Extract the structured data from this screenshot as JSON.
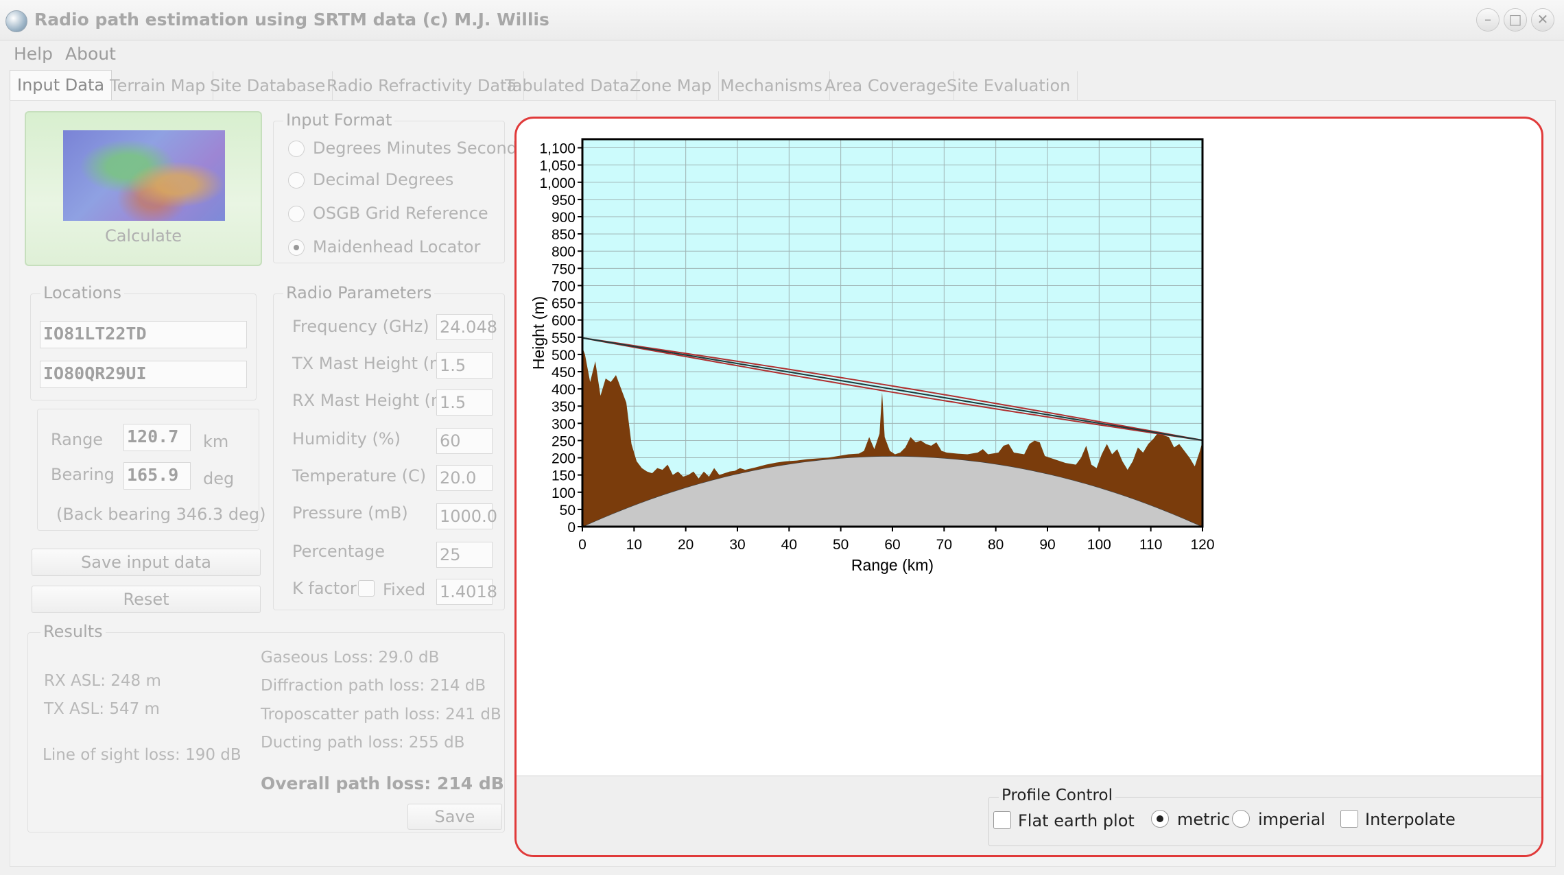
{
  "window": {
    "title": "Radio path estimation using SRTM data (c) M.J. Willis",
    "controls": {
      "minimize": "–",
      "maximize": "□",
      "close": "✕"
    }
  },
  "menu": [
    "Help",
    "About"
  ],
  "tabs": [
    "Input Data",
    "Terrain Map",
    "Site Database",
    "Radio Refractivity Data",
    "Tabulated Data",
    "Zone Map",
    "Mechanisms",
    "Area Coverage",
    "Site Evaluation"
  ],
  "calculate": {
    "label": "Calculate"
  },
  "input_format": {
    "legend": "Input Format",
    "options": [
      "Degrees Minutes Seconds",
      "Decimal Degrees",
      "OSGB Grid Reference",
      "Maidenhead Locator"
    ],
    "selected": "Maidenhead Locator"
  },
  "locations": {
    "legend": "Locations",
    "loc1": "IO81LT22TD",
    "loc2": "IO80QR29UI",
    "range_label": "Range",
    "range_value": "120.7",
    "range_unit": "km",
    "bearing_label": "Bearing",
    "bearing_value": "165.9",
    "bearing_unit": "deg",
    "back_bearing": "(Back bearing 346.3 deg)"
  },
  "buttons": {
    "save_input": "Save input data",
    "reset": "Reset",
    "save": "Save"
  },
  "radio_params": {
    "legend": "Radio Parameters",
    "frequency_label": "Frequency (GHz)",
    "frequency": "24.048",
    "tx_mast_label": "TX Mast Height (m)",
    "tx_mast": "1.5",
    "rx_mast_label": "RX Mast Height (m)",
    "rx_mast": "1.5",
    "humidity_label": "Humidity (%)",
    "humidity": "60",
    "temperature_label": "Temperature (C)",
    "temperature": "20.0",
    "pressure_label": "Pressure (mB)",
    "pressure": "1000.0",
    "percentage_label": "Percentage",
    "percentage": "25",
    "kfactor_label": "K factor",
    "fixed_label": "Fixed",
    "kfactor": "1.4018"
  },
  "results": {
    "legend": "Results",
    "rx_asl": "RX ASL: 248 m",
    "tx_asl": "TX ASL: 547 m",
    "los_loss": "Line of sight loss: 190 dB",
    "gaseous": "Gaseous Loss: 29.0 dB",
    "diffraction": "Diffraction path loss: 214 dB",
    "troposcatter": "Troposcatter path loss: 241 dB",
    "ducting": "Ducting path loss: 255 dB",
    "overall": "Overall path loss: 214 dB"
  },
  "chart_data": {
    "type": "area",
    "xlabel": "Range (km)",
    "ylabel": "Height (m)",
    "xlim": [
      0,
      120
    ],
    "ylim": [
      0,
      1125
    ],
    "x_ticks": [
      0,
      10,
      20,
      30,
      40,
      50,
      60,
      70,
      80,
      90,
      100,
      110,
      120
    ],
    "y_ticks": [
      "0",
      "50",
      "100",
      "150",
      "200",
      "250",
      "300",
      "350",
      "400",
      "450",
      "500",
      "550",
      "600",
      "650",
      "700",
      "750",
      "800",
      "850",
      "900",
      "950",
      "1,000",
      "1,050",
      "1,100"
    ],
    "grid": true,
    "earth_bulge": {
      "max_height": 205,
      "range_km": 120
    },
    "terrain": [
      [
        0,
        520
      ],
      [
        0.5,
        500
      ],
      [
        1.5,
        420
      ],
      [
        2.5,
        480
      ],
      [
        3.5,
        380
      ],
      [
        4.5,
        430
      ],
      [
        5.5,
        420
      ],
      [
        6.5,
        440
      ],
      [
        7.5,
        400
      ],
      [
        8.5,
        360
      ],
      [
        9.5,
        240
      ],
      [
        10.5,
        190
      ],
      [
        11.5,
        170
      ],
      [
        12.5,
        160
      ],
      [
        13.5,
        155
      ],
      [
        14.5,
        170
      ],
      [
        15.5,
        165
      ],
      [
        16.5,
        180
      ],
      [
        17.5,
        150
      ],
      [
        18.5,
        160
      ],
      [
        19.5,
        145
      ],
      [
        20.5,
        150
      ],
      [
        21.5,
        160
      ],
      [
        22.5,
        140
      ],
      [
        23.5,
        160
      ],
      [
        24.5,
        145
      ],
      [
        25.5,
        170
      ],
      [
        26.5,
        150
      ],
      [
        27.5,
        155
      ],
      [
        28.5,
        160
      ],
      [
        29.5,
        162
      ],
      [
        30.5,
        170
      ],
      [
        31.5,
        165
      ],
      [
        33.5,
        172
      ],
      [
        35.5,
        180
      ],
      [
        37.5,
        186
      ],
      [
        39.5,
        190
      ],
      [
        41.5,
        192
      ],
      [
        43.5,
        196
      ],
      [
        45.5,
        198
      ],
      [
        47.5,
        200
      ],
      [
        49.5,
        205
      ],
      [
        51.5,
        210
      ],
      [
        53.5,
        212
      ],
      [
        54.5,
        220
      ],
      [
        55.5,
        260
      ],
      [
        56.5,
        225
      ],
      [
        57.5,
        270
      ],
      [
        58,
        390
      ],
      [
        58.5,
        260
      ],
      [
        59.5,
        220
      ],
      [
        60.5,
        210
      ],
      [
        61.5,
        215
      ],
      [
        62.5,
        230
      ],
      [
        63.5,
        260
      ],
      [
        64.5,
        245
      ],
      [
        65.5,
        250
      ],
      [
        66.5,
        240
      ],
      [
        67.5,
        235
      ],
      [
        68.5,
        245
      ],
      [
        69.5,
        220
      ],
      [
        70.5,
        215
      ],
      [
        72.5,
        212
      ],
      [
        74.5,
        210
      ],
      [
        76.5,
        215
      ],
      [
        77.5,
        225
      ],
      [
        78.5,
        210
      ],
      [
        80.5,
        215
      ],
      [
        81.5,
        235
      ],
      [
        82.5,
        240
      ],
      [
        83.5,
        215
      ],
      [
        85.5,
        210
      ],
      [
        86.5,
        240
      ],
      [
        87.5,
        250
      ],
      [
        88.5,
        245
      ],
      [
        89.5,
        205
      ],
      [
        91.5,
        195
      ],
      [
        93.5,
        185
      ],
      [
        95.5,
        180
      ],
      [
        96.5,
        200
      ],
      [
        97.5,
        235
      ],
      [
        98.5,
        180
      ],
      [
        99.5,
        170
      ],
      [
        100.5,
        210
      ],
      [
        101.5,
        240
      ],
      [
        102.5,
        210
      ],
      [
        103.5,
        225
      ],
      [
        104.5,
        190
      ],
      [
        105.5,
        165
      ],
      [
        106.5,
        190
      ],
      [
        107.5,
        230
      ],
      [
        108.5,
        215
      ],
      [
        109.5,
        240
      ],
      [
        110.5,
        255
      ],
      [
        111.5,
        275
      ],
      [
        112.5,
        265
      ],
      [
        113.5,
        260
      ],
      [
        114.5,
        230
      ],
      [
        115.5,
        240
      ],
      [
        116.5,
        220
      ],
      [
        117.5,
        200
      ],
      [
        118.5,
        175
      ],
      [
        119.5,
        220
      ],
      [
        120.7,
        248
      ]
    ],
    "lines": {
      "tx_height": 548,
      "rx_height": 249,
      "fresnel_offset": 9,
      "colors": {
        "path": "#1a3a3a",
        "fresnel": "#b03030"
      }
    },
    "colors": {
      "sky": "#ccfbfc",
      "terrain": "#7a3c0c",
      "earth": "#c8c8c8",
      "grid": "#9fb3b3"
    }
  },
  "profile_control": {
    "legend": "Profile Control",
    "flat_earth": "Flat earth plot",
    "metric": "metric",
    "imperial": "imperial",
    "interpolate": "Interpolate",
    "selected": "metric"
  }
}
